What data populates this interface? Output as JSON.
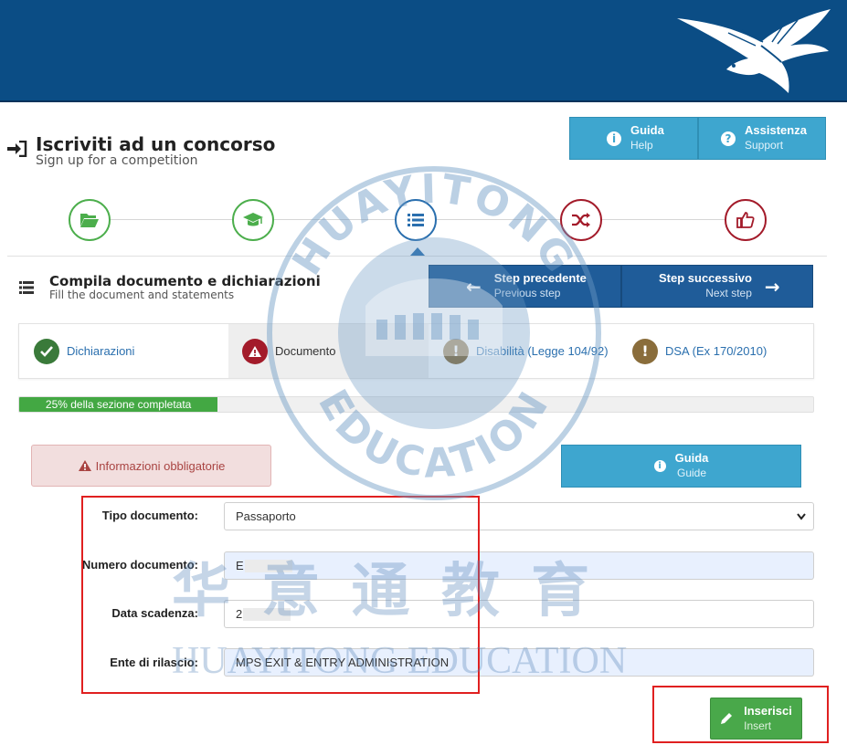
{
  "header": {
    "brand_color": "#0b4d85"
  },
  "page": {
    "title": "Iscriviti ad un concorso",
    "subtitle": "Sign up for a competition"
  },
  "top_buttons": {
    "guide": {
      "label": "Guida",
      "sublabel": "Help",
      "icon": "info-icon"
    },
    "support": {
      "label": "Assistenza",
      "sublabel": "Support",
      "icon": "question-icon"
    }
  },
  "stepper": {
    "steps": [
      {
        "icon": "folder-open-icon",
        "state": "completed",
        "color": "#4cae4c"
      },
      {
        "icon": "graduation-cap-icon",
        "state": "completed",
        "color": "#4cae4c"
      },
      {
        "icon": "list-icon",
        "state": "current",
        "color": "#2a6fae"
      },
      {
        "icon": "shuffle-icon",
        "state": "pending",
        "color": "#a31b2a"
      },
      {
        "icon": "thumbs-up-icon",
        "state": "pending",
        "color": "#a31b2a"
      }
    ]
  },
  "section": {
    "title": "Compila documento e dichiarazioni",
    "subtitle": "Fill the document and statements"
  },
  "nav": {
    "prev": {
      "label": "Step precedente",
      "sublabel": "Previous step"
    },
    "next": {
      "label": "Step successivo",
      "sublabel": "Next step"
    }
  },
  "subtabs": [
    {
      "label": "Dichiarazioni",
      "status": "done",
      "icon": "check-icon",
      "color": "#3a7a3a"
    },
    {
      "label": "Documento",
      "status": "error",
      "icon": "warning-icon",
      "color": "#a31b2a",
      "active": true
    },
    {
      "label": "Disabilità (Legge 104/92)",
      "status": "pending",
      "icon": "exclamation-icon",
      "color": "#8a6d3b"
    },
    {
      "label": "DSA (Ex 170/2010)",
      "status": "pending",
      "icon": "exclamation-icon",
      "color": "#8a6d3b"
    }
  ],
  "progress": {
    "label": "25% della sezione completata",
    "percent": 25
  },
  "alert": {
    "label": "Informazioni obbligatorie"
  },
  "guide_button": {
    "label": "Guida",
    "sublabel": "Guide"
  },
  "form": {
    "doc_type": {
      "label": "Tipo documento:",
      "value": "Passaporto"
    },
    "doc_number": {
      "label": "Numero documento:",
      "value": "E"
    },
    "expiry": {
      "label": "Data scadenza:",
      "value": "2"
    },
    "issuer": {
      "label": "Ente di rilascio:",
      "value": "MPS EXIT & ENTRY ADMINISTRATION"
    }
  },
  "insert_button": {
    "label": "Inserisci",
    "sublabel": "Insert"
  },
  "watermark": {
    "arc_text": "HUAYITONG",
    "arc_text_bottom": "EDUCATION",
    "chinese": "华 意 通 教 育",
    "latin": "HUAYITONG EDUCATION"
  }
}
